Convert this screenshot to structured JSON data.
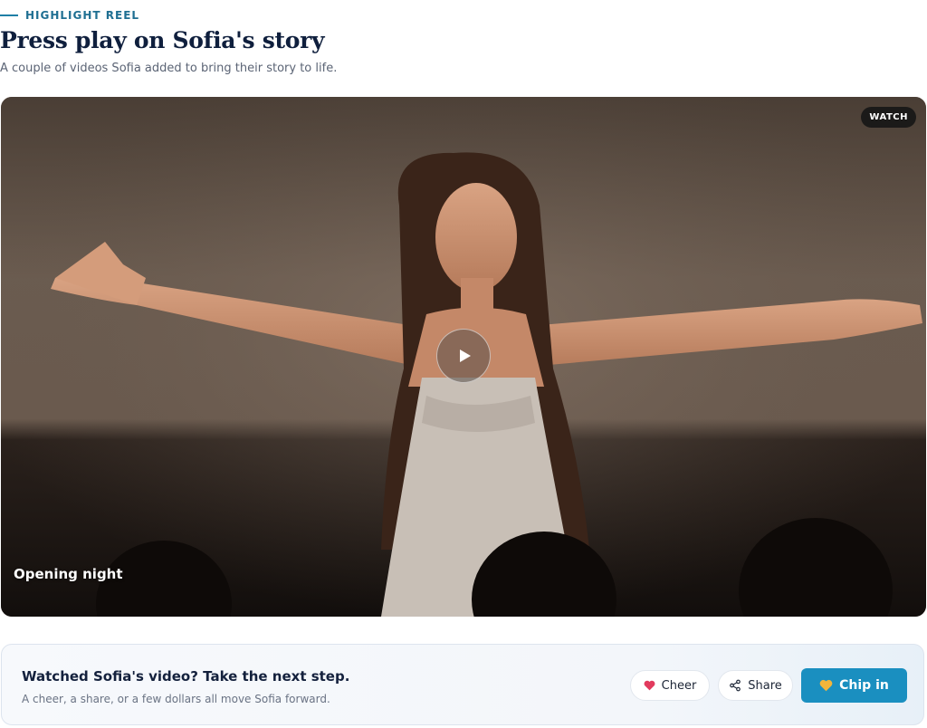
{
  "section": {
    "eyebrow": "HIGHLIGHT REEL",
    "title": "Press play on Sofia's story",
    "subtitle": "A couple of videos Sofia added to bring their story to life."
  },
  "video": {
    "badge": "WATCH",
    "caption": "Opening night",
    "play_icon": "play-icon"
  },
  "cta": {
    "title": "Watched Sofia's video? Take the next step.",
    "subtitle": "A cheer, a share, or a few dollars all move Sofia forward.",
    "cheer_label": "Cheer",
    "share_label": "Share",
    "chip_label": "Chip in",
    "cheer_icon": "heart-icon",
    "share_icon": "share-icon",
    "chip_icon": "yellow-heart-icon"
  },
  "colors": {
    "accent": "#1a8fc0",
    "heading": "#0f1f3d",
    "cheer_heart": "#e23b5e",
    "chip_heart": "#f2b53a"
  }
}
